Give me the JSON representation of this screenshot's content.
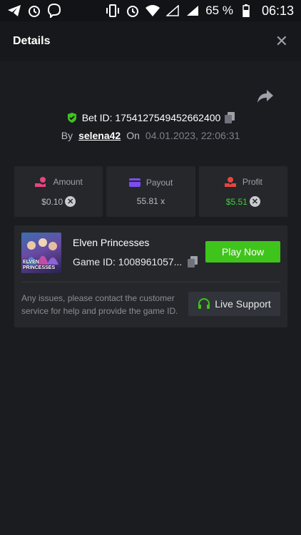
{
  "status_bar": {
    "battery_percent": "65 %",
    "time": "06:13"
  },
  "header": {
    "title": "Details",
    "close_symbol": "✕"
  },
  "bet": {
    "id_text": "Bet ID: 1754127549452662400",
    "by_label": "By",
    "username": "selena42",
    "on_label": "On",
    "date": "04.01.2023, 22:06:31"
  },
  "stats": [
    {
      "label": "Amount",
      "value": "$0.10",
      "icon": "coins-hand-icon",
      "color": "#e8457c"
    },
    {
      "label": "Payout",
      "value": "55.81 x",
      "icon": "card-icon",
      "color": "#7b4cf0"
    },
    {
      "label": "Profit",
      "value": "$5.51",
      "icon": "profit-hand-icon",
      "color": "#e8453c"
    }
  ],
  "game": {
    "thumbnail_text": "ELVEN PRINCESSES",
    "name": "Elven Princesses",
    "id_text": "Game ID: 1008961057...",
    "play_label": "Play Now"
  },
  "support": {
    "text": "Any issues, please contact the customer service for help and provide the game ID.",
    "button_label": "Live Support"
  },
  "colors": {
    "accent_green": "#3fc41b",
    "background": "#1b1c20",
    "card": "#25272b"
  }
}
